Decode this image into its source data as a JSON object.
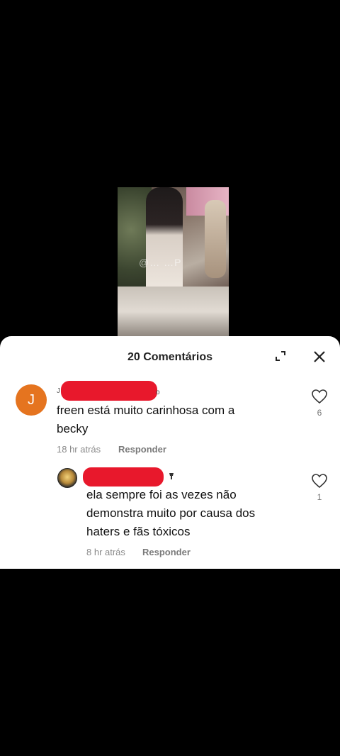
{
  "video": {
    "watermark": "@… …P"
  },
  "sheet": {
    "title": "20 Comentários"
  },
  "comments": [
    {
      "avatar_letter": "J",
      "text_line1": "freen está muito carinhosa com a",
      "text_line2": "becky",
      "time": "18 hr atrás",
      "reply_label": "Responder",
      "likes": "6"
    },
    {
      "text_line1": "ela sempre foi as vezes não",
      "text_line2": "demonstra muito por causa dos",
      "text_line3": "haters e fãs tóxicos",
      "time": "8 hr atrás",
      "reply_label": "Responder",
      "likes": "1"
    }
  ],
  "colors": {
    "redaction": "#e8182c",
    "avatar_j": "#e5741f"
  }
}
